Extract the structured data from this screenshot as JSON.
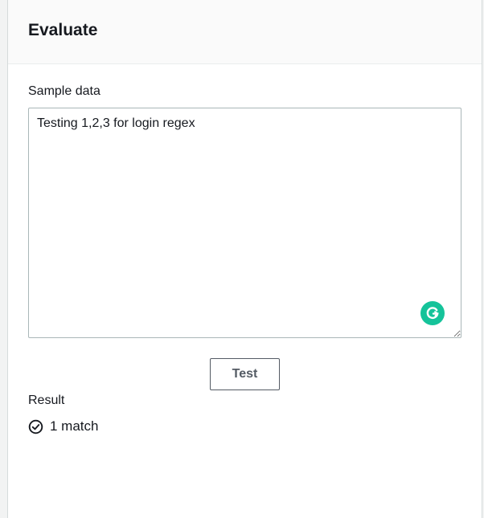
{
  "panel": {
    "title": "Evaluate"
  },
  "sample": {
    "label": "Sample data",
    "value": "Testing 1,2,3 for login regex",
    "badge_icon": "grammarly-icon"
  },
  "actions": {
    "test_label": "Test"
  },
  "result": {
    "label": "Result",
    "icon": "check-circle-icon",
    "text": "1 match"
  },
  "colors": {
    "accent_badge": "#15c39a",
    "text": "#16191f",
    "border": "#aab7b8"
  }
}
